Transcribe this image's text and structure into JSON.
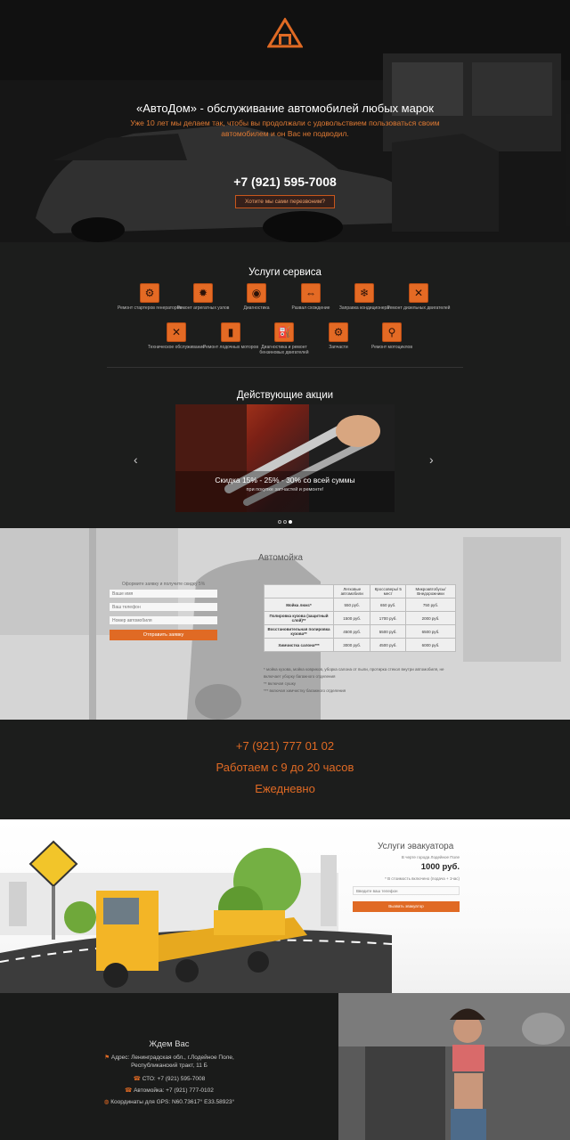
{
  "hero": {
    "title": "«АвтоДом» - обслуживание автомобилей любых марок",
    "subtitle": "Уже 10 лет мы делаем так, чтобы вы продолжали с удовольствием пользоваться своим автомобилем и он Вас не подводил.",
    "phone": "+7 (921) 595-7008",
    "callback_label": "Хотите мы сами перезвоним?"
  },
  "services": {
    "title": "Услуги сервиса",
    "items": [
      {
        "label": "Ремонт стартеров генераторов",
        "icon": "starter-icon"
      },
      {
        "label": "Ремонт агрегатных узлов",
        "icon": "gears-icon"
      },
      {
        "label": "Диагностика",
        "icon": "diagnostics-icon"
      },
      {
        "label": "Развал схождение",
        "icon": "alignment-icon"
      },
      {
        "label": "Заправка кондиционера",
        "icon": "ac-icon"
      },
      {
        "label": "Ремонт дизельных двигателей",
        "icon": "wrenches-icon"
      },
      {
        "label": "Техническое обслуживание",
        "icon": "maintenance-icon"
      },
      {
        "label": "Ремонт лодочных моторов",
        "icon": "boat-engine-icon"
      },
      {
        "label": "Диагностика и ремонт бензиновых двигателей",
        "icon": "fuel-icon"
      },
      {
        "label": "Запчасти",
        "icon": "parts-icon"
      },
      {
        "label": "Ремонт мотоциклов",
        "icon": "motorcycle-icon"
      }
    ]
  },
  "promo": {
    "title": "Действующие акции",
    "slide_text": "Скидка 15% - 25% - 30% со всей суммы",
    "slide_sub": "при покупке запчастей и ремонте!",
    "prev_label": "‹",
    "next_label": "›"
  },
  "wash": {
    "title": "Автомойка",
    "form_hint": "Оформите заявку и получите скидку 5%",
    "name_placeholder": "Ваше имя",
    "phone_placeholder": "Ваш телефон",
    "car_placeholder": "Номер автомобиля",
    "submit_label": "Отправить заявку",
    "table": {
      "headers": [
        "",
        "Легковые автомобили",
        "Кроссоверы/ 5 мест",
        "Микроавтобусы/ Внедорожники"
      ],
      "rows": [
        [
          "Мойка люкс*",
          "550 руб.",
          "650 руб.",
          "750 руб."
        ],
        [
          "Полировка кузова (защитный слой)**",
          "1500 руб.",
          "1700 руб.",
          "2000 руб."
        ],
        [
          "Восстановительная полировка кузова**",
          "4500 руб.",
          "5500 руб.",
          "6500 руб."
        ],
        [
          "Химчистка салона***",
          "3000 руб.",
          "4500 руб.",
          "6000 руб."
        ]
      ]
    },
    "notes": [
      "* мойка кузова, мойка ковриков, уборка салона от пыли, протирка стекол внутри автомобиля, не включает уборку багажного отделения",
      "** включая сушку",
      "*** включая химчистку багажного отделения"
    ]
  },
  "band": {
    "phone": "+7 (921) 777 01 02",
    "hours": "Работаем с 9 до 20 часов",
    "days": "Ежедневно"
  },
  "tow": {
    "title": "Услуги эвакуатора",
    "note": "В черте города Лодейное Поле",
    "price": "1000 руб.",
    "note2": "* В стоимость включено (подача + 1час)",
    "phone_placeholder": "Введите ваш телефон",
    "submit_label": "Вызвать эвакуатор"
  },
  "footer": {
    "title": "Ждем Вас",
    "address": "Адрес: Ленинградская обл., г.Лодейное Поле, Республиканский тракт, 11 Б",
    "sto": "СТО: +7 (921) 595-7008",
    "wash": "Автомойка: +7 (921) 777-0102",
    "gps": "Координаты для GPS: N60.73617° E33.58923°"
  },
  "colors": {
    "accent": "#e06a24",
    "dark": "#1c1d1c"
  }
}
